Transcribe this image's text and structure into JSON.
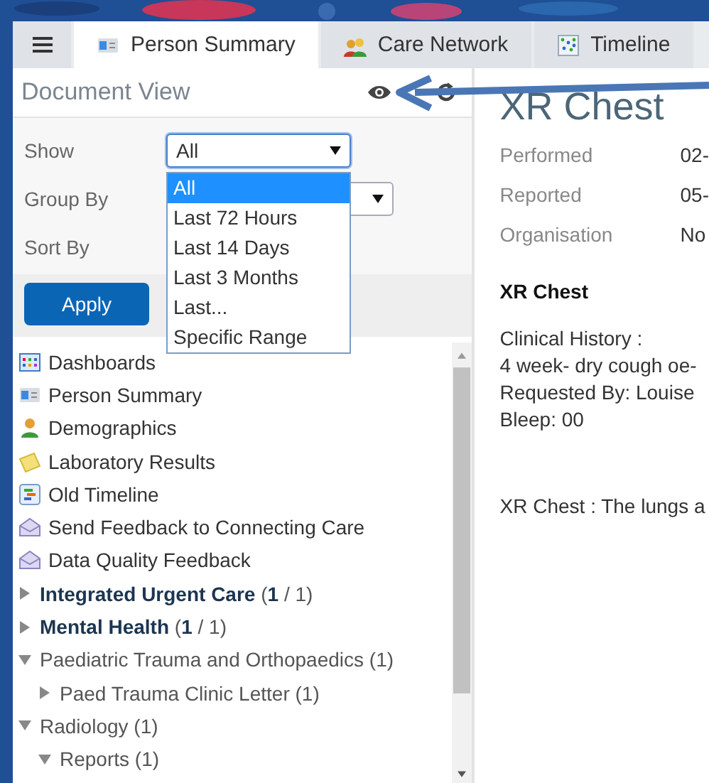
{
  "tabs": [
    {
      "kind": "menu",
      "selected": false
    },
    {
      "kind": "tab",
      "label": "Person Summary",
      "selected": true
    },
    {
      "kind": "tab",
      "label": "Care Network",
      "selected": false
    },
    {
      "kind": "tab",
      "label": "Timeline",
      "selected": false
    }
  ],
  "document_view": {
    "title": "Document View",
    "filters": [
      {
        "kind": "select",
        "label": "Show",
        "value": "All",
        "expanded": true,
        "options": [
          {
            "label": "All",
            "selected": true
          },
          {
            "label": "Last 72 Hours",
            "selected": false
          },
          {
            "label": "Last 14 Days",
            "selected": false
          },
          {
            "label": "Last 3 Months",
            "selected": false
          },
          {
            "label": "Last...",
            "selected": false
          },
          {
            "label": "Specific Range",
            "selected": false
          }
        ]
      },
      {
        "kind": "select",
        "label": "Group By"
      },
      {
        "kind": "plain",
        "label": "Sort By"
      }
    ],
    "apply_button": "Apply",
    "links": [
      "Dashboards",
      "Person Summary",
      "Demographics",
      "Laboratory Results",
      "Old Timeline",
      "Send Feedback to Connecting Care",
      "Data Quality Feedback"
    ],
    "folders": [
      {
        "label": "**Integrated Urgent Care** (**1** / 1)",
        "expanded": false
      },
      {
        "label": "**Mental Health** (**1** / 1)",
        "expanded": false
      },
      {
        "label": "Paediatric Trauma and Orthopaedics (1)",
        "expanded": true,
        "children": [
          {
            "label": "Paed Trauma Clinic Letter (1)",
            "expanded": false
          }
        ]
      },
      {
        "label": "Radiology (1)",
        "expanded": true,
        "children": [
          {
            "label": "Reports (1)",
            "expanded": true
          }
        ]
      }
    ]
  },
  "document": {
    "title": "XR Chest",
    "fields": [
      {
        "label": "Performed",
        "value": "02-"
      },
      {
        "label": "Reported",
        "value": "05-"
      },
      {
        "label": "Organisation",
        "value": "No"
      }
    ],
    "heading": "XR Chest",
    "clinical_lines": [
      "Clinical History :",
      "4 week- dry cough oe-",
      "Requested By: Louise",
      "Bleep: 00"
    ],
    "report": "XR Chest : The lungs a"
  }
}
